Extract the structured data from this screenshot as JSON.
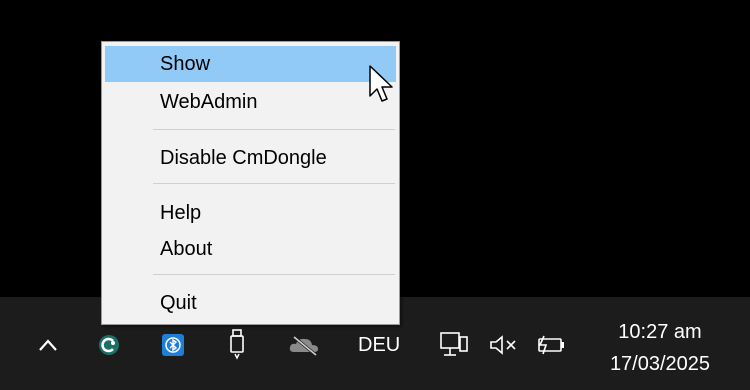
{
  "context_menu": {
    "items": [
      {
        "label": "Show",
        "highlighted": true
      },
      {
        "label": "WebAdmin"
      },
      {
        "label": "Disable CmDongle"
      },
      {
        "label": "Help"
      },
      {
        "label": "About"
      },
      {
        "label": "Quit"
      }
    ],
    "highlight_color": "#91c9f7"
  },
  "taskbar": {
    "tray_icons": [
      "chevron-up-icon",
      "codemeter-icon",
      "bluetooth-icon",
      "usb-drive-icon",
      "onedrive-offline-icon",
      "network-icon",
      "speaker-muted-icon",
      "battery-charging-icon"
    ],
    "language": "DEU",
    "time": "10:27 am",
    "date": "17/03/2025"
  }
}
